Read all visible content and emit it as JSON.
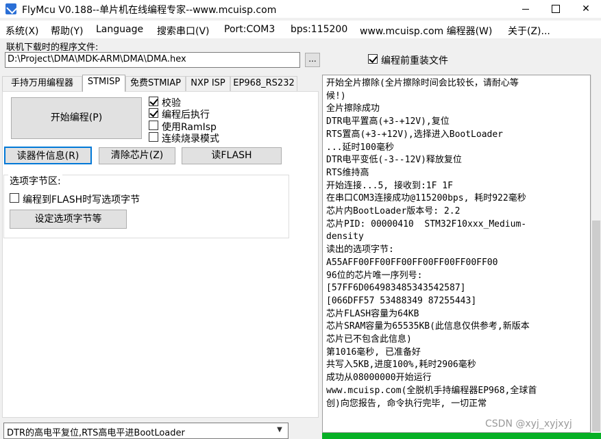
{
  "window": {
    "title": "FlyMcu V0.188--单片机在线编程专家--www.mcuisp.com"
  },
  "menu": [
    "系统(X)",
    "帮助(Y)",
    "Language",
    "搜索串口(V)",
    "Port:COM3",
    "bps:115200",
    "www.mcuisp.com 编程器(W)",
    "关于(Z)..."
  ],
  "file": {
    "label": "联机下载时的程序文件:",
    "path": "D:\\Project\\DMA\\MDK-ARM\\DMA\\DMA.hex",
    "browse_label": "...",
    "reload_label": "编程前重装文件",
    "reload_checked": true
  },
  "tabs": [
    "手持万用编程器",
    "STMISP",
    "免费STMIAP",
    "NXP ISP",
    "EP968_RS232"
  ],
  "active_tab": "STMISP",
  "buttons": {
    "start": "开始编程(P)",
    "read_info": "读器件信息(R)",
    "erase": "清除芯片(Z)",
    "read_flash": "读FLASH"
  },
  "options": [
    {
      "label": "校验",
      "checked": true
    },
    {
      "label": "编程后执行",
      "checked": true
    },
    {
      "label": "使用RamIsp",
      "checked": false
    },
    {
      "label": "连续烧录模式",
      "checked": false
    }
  ],
  "option_bytes": {
    "title": "选项字节区:",
    "write_label": "编程到FLASH时写选项字节",
    "write_checked": false,
    "set_button": "设定选项字节等"
  },
  "dtr_select": {
    "value": "DTR的高电平复位,RTS高电平进BootLoader"
  },
  "log": [
    "开始全片擦除(全片擦除时间会比较长，请耐心等",
    "候!)",
    "全片擦除成功",
    "DTR电平置高(+3-+12V),复位",
    "RTS置高(+3-+12V),选择进入BootLoader",
    "...延时100毫秒",
    "DTR电平变低(-3--12V)释放复位",
    "RTS维持高",
    "开始连接...5, 接收到:1F 1F",
    "在串口COM3连接成功@115200bps, 耗时922毫秒",
    "芯片内BootLoader版本号: 2.2",
    "芯片PID: 00000410  STM32F10xxx_Medium-",
    "density",
    "读出的选项字节:",
    "A55AFF00FF00FF00FF00FF00FF00FF00",
    "96位的芯片唯一序列号:",
    "[57FF6D064983485343542587]",
    "[066DFF57 53488349 87255443]",
    "芯片FLASH容量为64KB",
    "芯片SRAM容量为65535KB(此信息仅供参考,新版本",
    "芯片已不包含此信息)",
    "第1016毫秒, 已准备好",
    "共写入5KB,进度100%,耗时2906毫秒",
    "成功从08000000开始运行",
    "www.mcuisp.com(全脱机手持编程器EP968,全球首",
    "创)向您报告, 命令执行完毕, 一切正常"
  ],
  "progress": 1.0,
  "watermark": "CSDN @xyj_xyjxyj",
  "colors": {
    "progress": "#06b025",
    "focus_border": "#0078d7"
  }
}
